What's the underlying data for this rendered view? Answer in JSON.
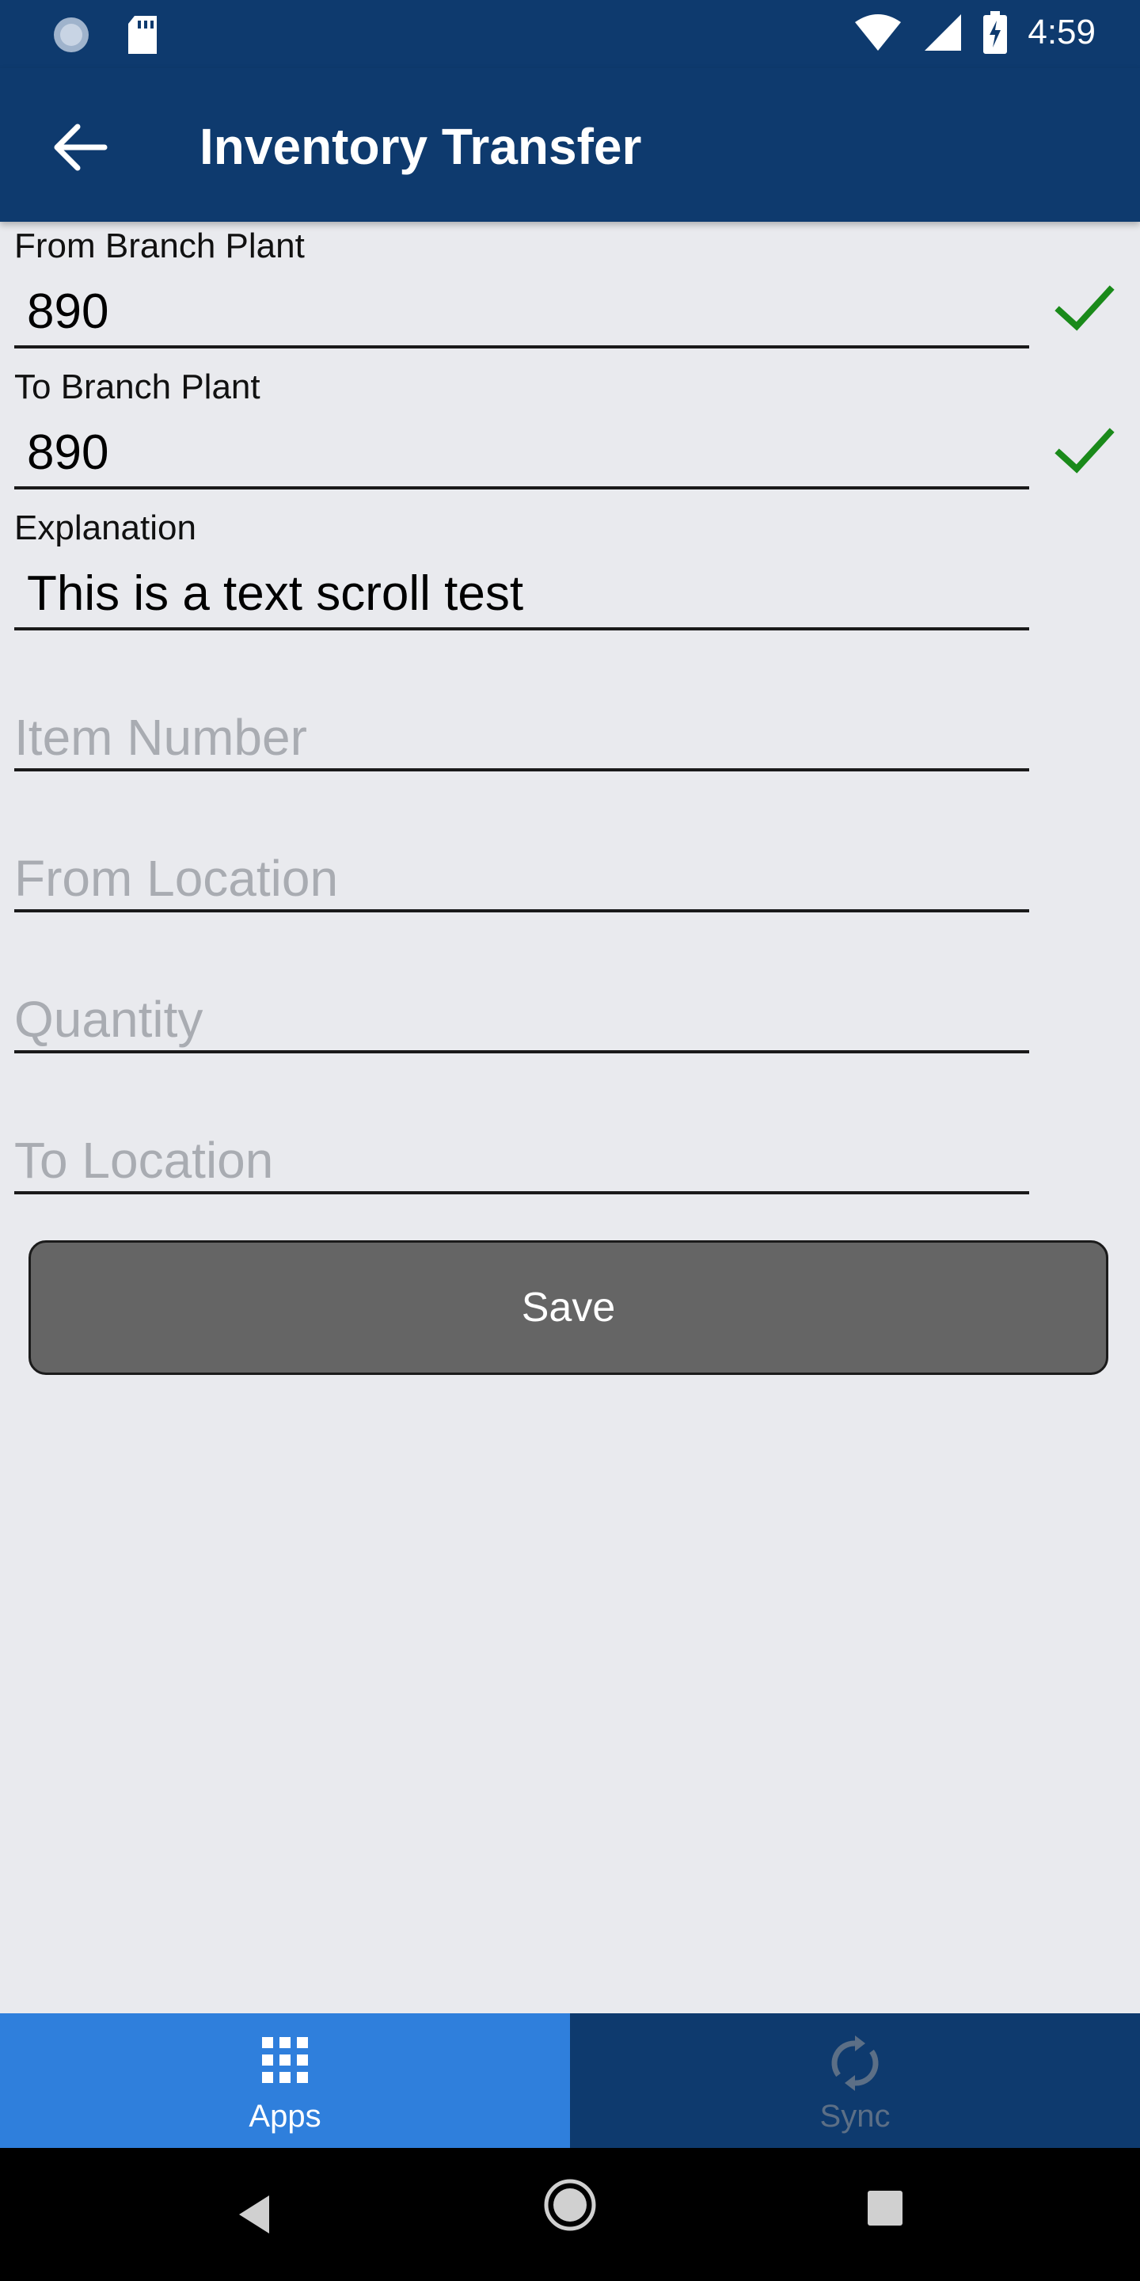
{
  "status_bar": {
    "time": "4:59"
  },
  "app_bar": {
    "title": "Inventory Transfer"
  },
  "fields": {
    "from_branch_plant": {
      "label": "From Branch Plant",
      "value": "890"
    },
    "to_branch_plant": {
      "label": "To Branch Plant",
      "value": "890"
    },
    "explanation": {
      "label": "Explanation",
      "value": "This is a text scroll test"
    },
    "item_number": {
      "placeholder": "Item Number"
    },
    "from_location": {
      "placeholder": "From Location"
    },
    "quantity": {
      "placeholder": "Quantity"
    },
    "to_location": {
      "placeholder": "To Location"
    }
  },
  "save_button": {
    "label": "Save"
  },
  "bottom_tabs": [
    {
      "label": "Apps",
      "icon": "grid-icon",
      "selected": true
    },
    {
      "label": "Sync",
      "icon": "sync-icon",
      "selected": false
    }
  ],
  "colors": {
    "header": "#0e3a6e",
    "selected_tab": "#2f7fdc",
    "check": "#1a8a1a",
    "save_button": "#656565"
  }
}
